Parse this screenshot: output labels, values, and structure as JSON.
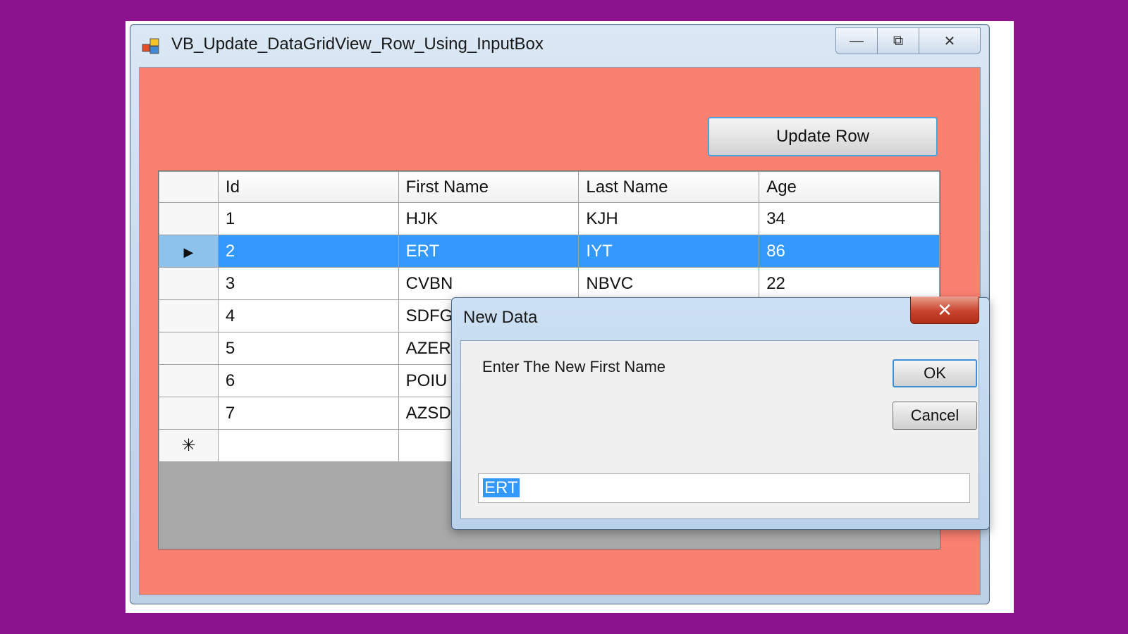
{
  "window": {
    "title": "VB_Update_DataGridView_Row_Using_InputBox",
    "minimize_glyph": "—",
    "maximize_glyph": "⧉",
    "close_glyph": "✕"
  },
  "toolbar": {
    "update_row_label": "Update Row"
  },
  "grid": {
    "columns": [
      "Id",
      "First Name",
      "Last Name",
      "Age"
    ],
    "rows": [
      {
        "id": "1",
        "first": "HJK",
        "last": "KJH",
        "age": "34"
      },
      {
        "id": "2",
        "first": "ERT",
        "last": "IYT",
        "age": "86"
      },
      {
        "id": "3",
        "first": "CVBN",
        "last": "NBVC",
        "age": "22"
      },
      {
        "id": "4",
        "first": "SDFG",
        "last": "",
        "age": ""
      },
      {
        "id": "5",
        "first": "AZER",
        "last": "",
        "age": ""
      },
      {
        "id": "6",
        "first": "POIU",
        "last": "",
        "age": ""
      },
      {
        "id": "7",
        "first": "AZSD",
        "last": "",
        "age": ""
      }
    ],
    "selected_row_index": 1,
    "current_row_marker": "▶",
    "new_row_marker": "✳"
  },
  "dialog": {
    "title": "New Data",
    "close_glyph": "✕",
    "prompt": "Enter The New First Name",
    "ok_label": "OK",
    "cancel_label": "Cancel",
    "input_value": "ERT"
  },
  "colors": {
    "client_background": "#fa8072",
    "selection": "#3399ff",
    "frame": "#8b138d"
  }
}
